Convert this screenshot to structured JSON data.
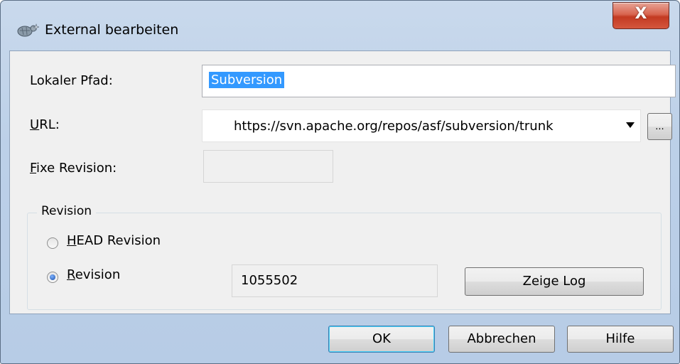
{
  "window": {
    "title": "External bearbeiten",
    "close_label": "X"
  },
  "form": {
    "local_path": {
      "label_prefix": "L",
      "label_rest": "okaler Pfad:",
      "value": "Subversion"
    },
    "url": {
      "label_prefix": "U",
      "label_rest": "RL:",
      "value": "https://svn.apache.org/repos/asf/subversion/trunk",
      "browse_label": "..."
    },
    "fixed_revision": {
      "label_prefix": "F",
      "label_rest": "ixe Revision:",
      "value": ""
    }
  },
  "revision_group": {
    "title": "Revision",
    "head_option": {
      "label_prefix": "H",
      "label_rest": "EAD Revision",
      "selected": false
    },
    "revision_option": {
      "label_prefix": "R",
      "label_rest": "evision",
      "selected": true
    },
    "revision_value": "1055502",
    "show_log_label": "Zeige Log"
  },
  "buttons": {
    "ok": "OK",
    "cancel": "Abbrechen",
    "help": "Hilfe"
  }
}
